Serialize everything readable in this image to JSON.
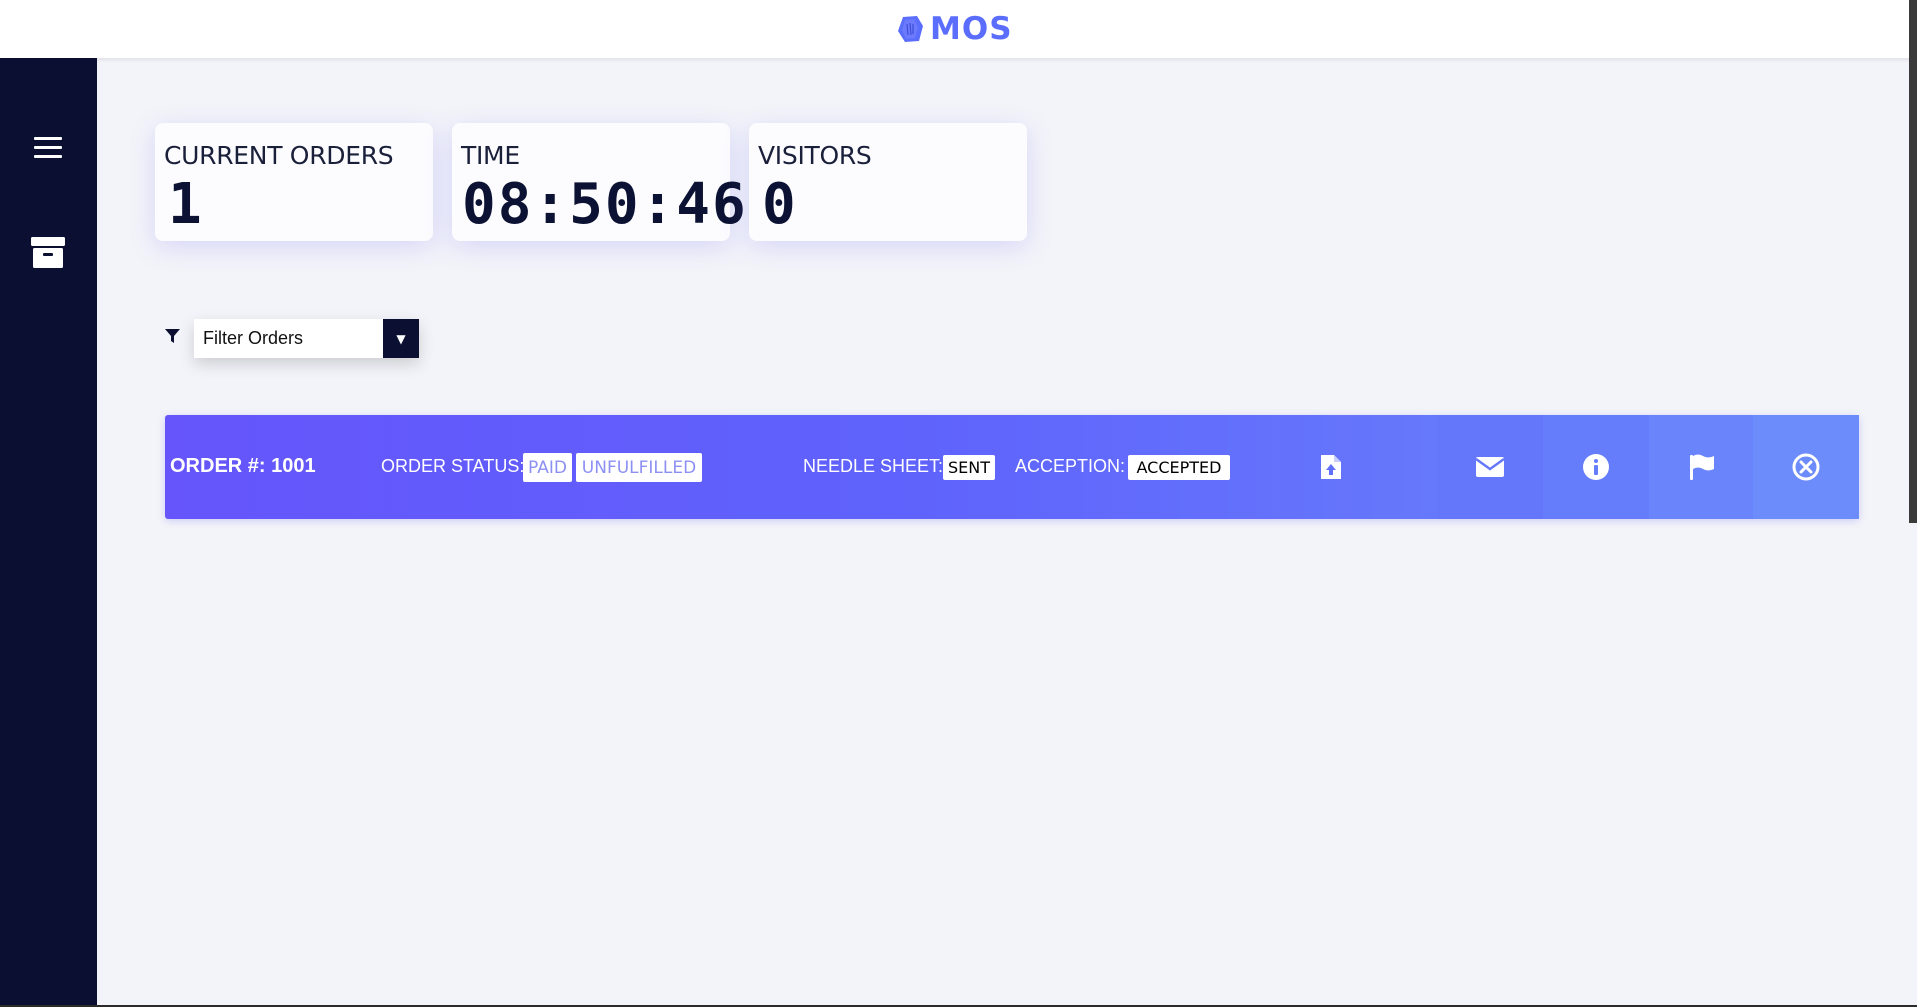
{
  "app": {
    "name": "MOS",
    "accent_color": "#5a6dfc"
  },
  "sidebar": {
    "background": "#0b1033",
    "items": [
      {
        "icon": "hamburger-menu-icon"
      },
      {
        "icon": "archive-box-icon"
      }
    ]
  },
  "stats": [
    {
      "label": "CURRENT ORDERS",
      "value": "1"
    },
    {
      "label": "TIME",
      "value": "08:50:46"
    },
    {
      "label": "VISITORS",
      "value": "0"
    }
  ],
  "filter": {
    "icon": "filter-icon",
    "selected": "Filter Orders",
    "arrow": "▼"
  },
  "order": {
    "number_label": "ORDER #: 1001",
    "status_label": "ORDER STATUS:",
    "status_tags": [
      "PAID",
      "UNFULFILLED"
    ],
    "needle_sheet_label": "NEEDLE SHEET:",
    "needle_sheet_value": "SENT",
    "acception_label": "ACCEPTION:",
    "acception_value": "ACCEPTED",
    "actions": [
      "upload-file-icon",
      "envelope-icon",
      "info-icon",
      "flag-icon",
      "close-circle-icon"
    ],
    "action_colors": [
      "#6170fb",
      "#6477fb",
      "#667dfb",
      "#6a84fb",
      "#6d8cfb"
    ]
  }
}
